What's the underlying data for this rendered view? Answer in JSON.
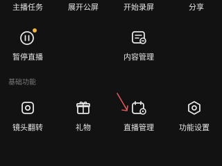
{
  "top_row": {
    "items": [
      {
        "label": "主播任务"
      },
      {
        "label": "展开公屏"
      },
      {
        "label": "开始录屏"
      },
      {
        "label": "分享"
      }
    ]
  },
  "row_two": {
    "items": [
      {
        "label": "暂停直播",
        "icon": "pause-icon",
        "badge_color": "#f3b63f"
      },
      {
        "label": "内容管理",
        "icon": "content-manage-icon"
      }
    ]
  },
  "basic_functions": {
    "title": "基础功能",
    "items": [
      {
        "label": "镜头翻转",
        "icon": "camera-flip-icon"
      },
      {
        "label": "礼物",
        "icon": "gift-icon"
      },
      {
        "label": "直播管理",
        "icon": "live-manage-icon"
      },
      {
        "label": "功能设置",
        "icon": "settings-hexagon-icon"
      }
    ]
  },
  "annotation": {
    "color": "#e0565a",
    "icon": "red-arrow-annotation"
  }
}
